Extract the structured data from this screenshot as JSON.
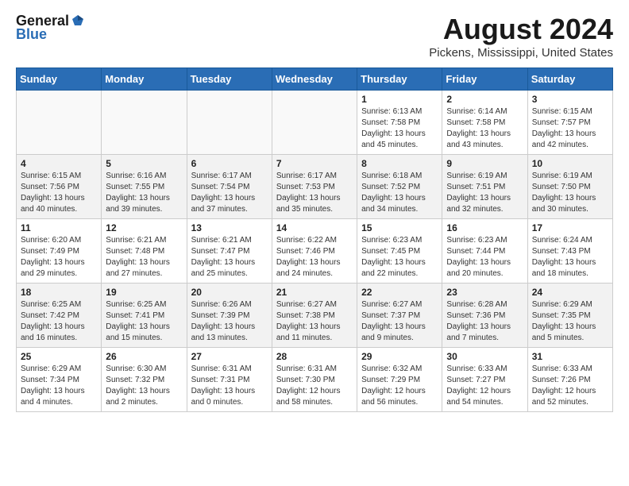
{
  "logo": {
    "general": "General",
    "blue": "Blue"
  },
  "header": {
    "month": "August 2024",
    "location": "Pickens, Mississippi, United States"
  },
  "weekdays": [
    "Sunday",
    "Monday",
    "Tuesday",
    "Wednesday",
    "Thursday",
    "Friday",
    "Saturday"
  ],
  "weeks": [
    {
      "shaded": false,
      "days": [
        {
          "num": "",
          "info": ""
        },
        {
          "num": "",
          "info": ""
        },
        {
          "num": "",
          "info": ""
        },
        {
          "num": "",
          "info": ""
        },
        {
          "num": "1",
          "info": "Sunrise: 6:13 AM\nSunset: 7:58 PM\nDaylight: 13 hours and 45 minutes."
        },
        {
          "num": "2",
          "info": "Sunrise: 6:14 AM\nSunset: 7:58 PM\nDaylight: 13 hours and 43 minutes."
        },
        {
          "num": "3",
          "info": "Sunrise: 6:15 AM\nSunset: 7:57 PM\nDaylight: 13 hours and 42 minutes."
        }
      ]
    },
    {
      "shaded": true,
      "days": [
        {
          "num": "4",
          "info": "Sunrise: 6:15 AM\nSunset: 7:56 PM\nDaylight: 13 hours and 40 minutes."
        },
        {
          "num": "5",
          "info": "Sunrise: 6:16 AM\nSunset: 7:55 PM\nDaylight: 13 hours and 39 minutes."
        },
        {
          "num": "6",
          "info": "Sunrise: 6:17 AM\nSunset: 7:54 PM\nDaylight: 13 hours and 37 minutes."
        },
        {
          "num": "7",
          "info": "Sunrise: 6:17 AM\nSunset: 7:53 PM\nDaylight: 13 hours and 35 minutes."
        },
        {
          "num": "8",
          "info": "Sunrise: 6:18 AM\nSunset: 7:52 PM\nDaylight: 13 hours and 34 minutes."
        },
        {
          "num": "9",
          "info": "Sunrise: 6:19 AM\nSunset: 7:51 PM\nDaylight: 13 hours and 32 minutes."
        },
        {
          "num": "10",
          "info": "Sunrise: 6:19 AM\nSunset: 7:50 PM\nDaylight: 13 hours and 30 minutes."
        }
      ]
    },
    {
      "shaded": false,
      "days": [
        {
          "num": "11",
          "info": "Sunrise: 6:20 AM\nSunset: 7:49 PM\nDaylight: 13 hours and 29 minutes."
        },
        {
          "num": "12",
          "info": "Sunrise: 6:21 AM\nSunset: 7:48 PM\nDaylight: 13 hours and 27 minutes."
        },
        {
          "num": "13",
          "info": "Sunrise: 6:21 AM\nSunset: 7:47 PM\nDaylight: 13 hours and 25 minutes."
        },
        {
          "num": "14",
          "info": "Sunrise: 6:22 AM\nSunset: 7:46 PM\nDaylight: 13 hours and 24 minutes."
        },
        {
          "num": "15",
          "info": "Sunrise: 6:23 AM\nSunset: 7:45 PM\nDaylight: 13 hours and 22 minutes."
        },
        {
          "num": "16",
          "info": "Sunrise: 6:23 AM\nSunset: 7:44 PM\nDaylight: 13 hours and 20 minutes."
        },
        {
          "num": "17",
          "info": "Sunrise: 6:24 AM\nSunset: 7:43 PM\nDaylight: 13 hours and 18 minutes."
        }
      ]
    },
    {
      "shaded": true,
      "days": [
        {
          "num": "18",
          "info": "Sunrise: 6:25 AM\nSunset: 7:42 PM\nDaylight: 13 hours and 16 minutes."
        },
        {
          "num": "19",
          "info": "Sunrise: 6:25 AM\nSunset: 7:41 PM\nDaylight: 13 hours and 15 minutes."
        },
        {
          "num": "20",
          "info": "Sunrise: 6:26 AM\nSunset: 7:39 PM\nDaylight: 13 hours and 13 minutes."
        },
        {
          "num": "21",
          "info": "Sunrise: 6:27 AM\nSunset: 7:38 PM\nDaylight: 13 hours and 11 minutes."
        },
        {
          "num": "22",
          "info": "Sunrise: 6:27 AM\nSunset: 7:37 PM\nDaylight: 13 hours and 9 minutes."
        },
        {
          "num": "23",
          "info": "Sunrise: 6:28 AM\nSunset: 7:36 PM\nDaylight: 13 hours and 7 minutes."
        },
        {
          "num": "24",
          "info": "Sunrise: 6:29 AM\nSunset: 7:35 PM\nDaylight: 13 hours and 5 minutes."
        }
      ]
    },
    {
      "shaded": false,
      "days": [
        {
          "num": "25",
          "info": "Sunrise: 6:29 AM\nSunset: 7:34 PM\nDaylight: 13 hours and 4 minutes."
        },
        {
          "num": "26",
          "info": "Sunrise: 6:30 AM\nSunset: 7:32 PM\nDaylight: 13 hours and 2 minutes."
        },
        {
          "num": "27",
          "info": "Sunrise: 6:31 AM\nSunset: 7:31 PM\nDaylight: 13 hours and 0 minutes."
        },
        {
          "num": "28",
          "info": "Sunrise: 6:31 AM\nSunset: 7:30 PM\nDaylight: 12 hours and 58 minutes."
        },
        {
          "num": "29",
          "info": "Sunrise: 6:32 AM\nSunset: 7:29 PM\nDaylight: 12 hours and 56 minutes."
        },
        {
          "num": "30",
          "info": "Sunrise: 6:33 AM\nSunset: 7:27 PM\nDaylight: 12 hours and 54 minutes."
        },
        {
          "num": "31",
          "info": "Sunrise: 6:33 AM\nSunset: 7:26 PM\nDaylight: 12 hours and 52 minutes."
        }
      ]
    }
  ]
}
